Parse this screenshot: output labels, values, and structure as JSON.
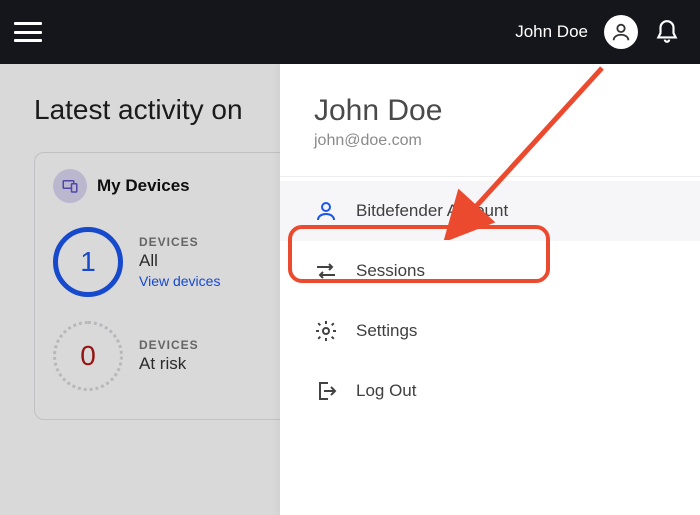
{
  "topbar": {
    "user_name": "John Doe"
  },
  "page": {
    "title": "Latest activity on"
  },
  "my_devices": {
    "title": "My Devices",
    "total": {
      "count": "1",
      "label": "DEVICES",
      "sub": "All",
      "link": "View devices"
    },
    "at_risk": {
      "count": "0",
      "label": "DEVICES",
      "sub": "At risk"
    }
  },
  "dropdown": {
    "name": "John Doe",
    "email": "john@doe.com",
    "items": {
      "account": "Bitdefender Account",
      "sessions": "Sessions",
      "settings": "Settings",
      "logout": "Log Out"
    }
  }
}
